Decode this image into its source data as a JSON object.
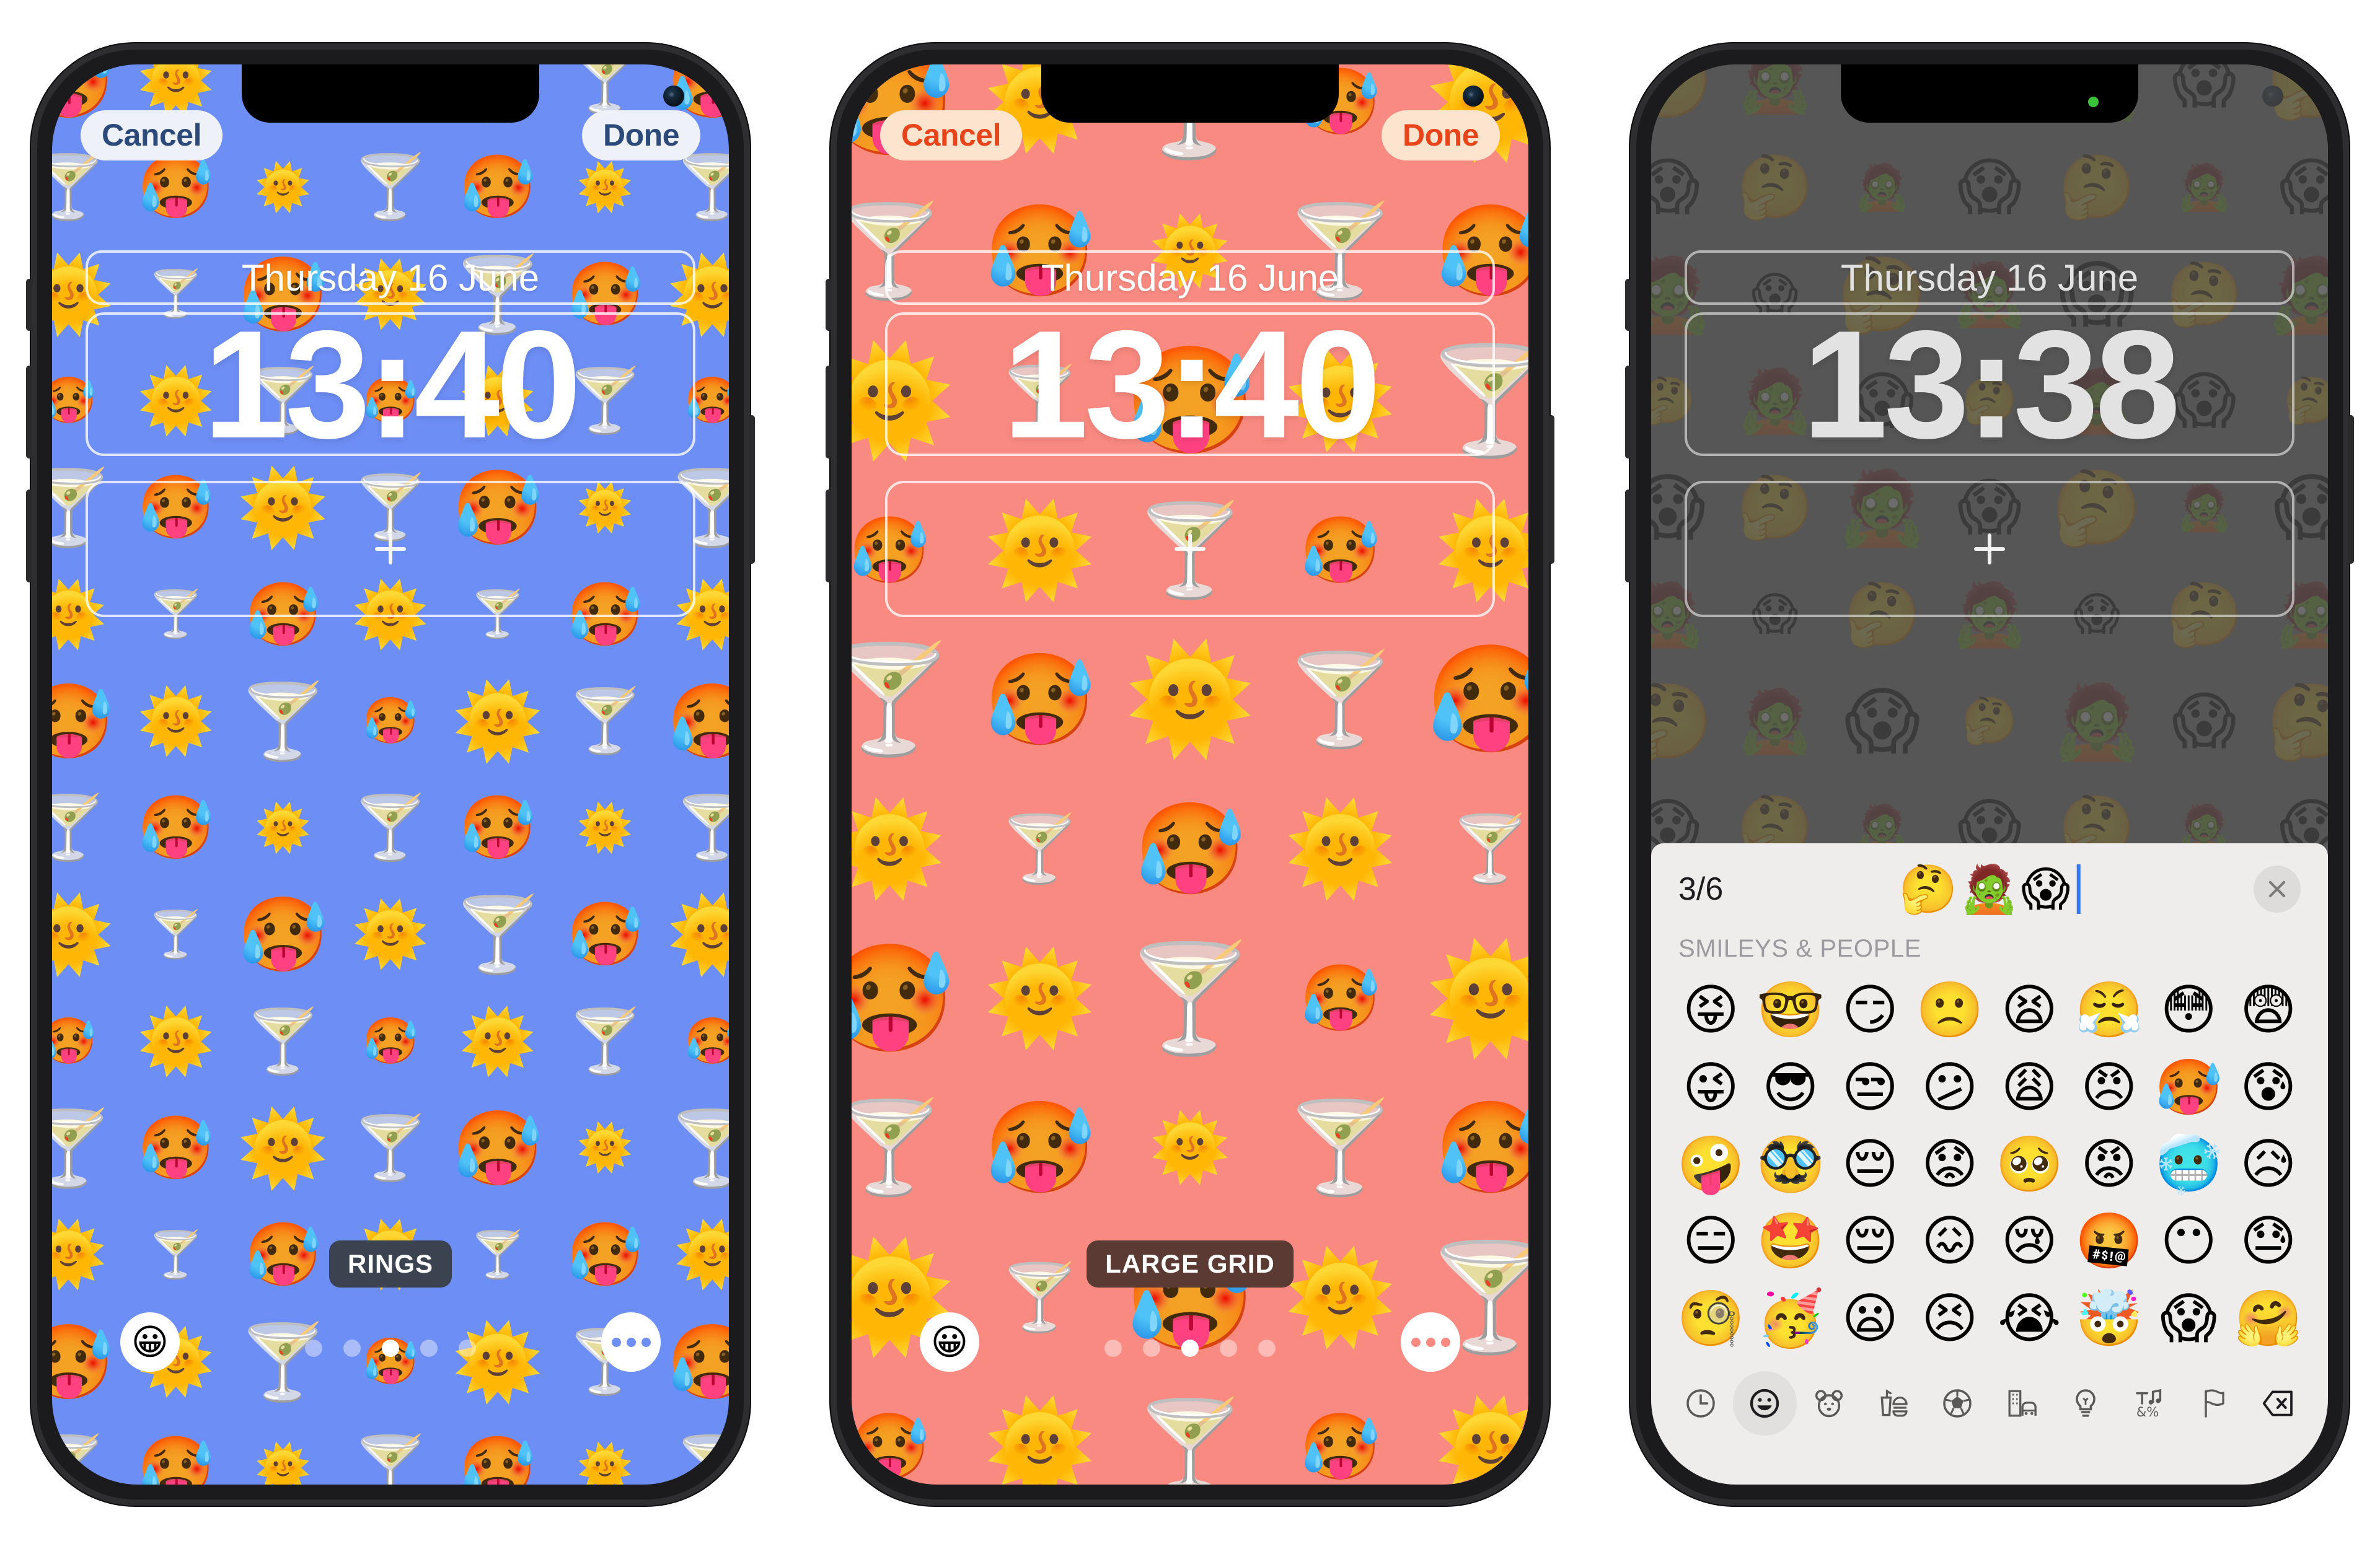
{
  "colors": {
    "phone1_bg": "#6d8ef5",
    "phone2_bg": "#f98a81",
    "phone3_bg": "#8a8a8a",
    "accent_blue": "#2b4a7a",
    "accent_red": "#e8441a",
    "badge_dark": "#3b4250",
    "badge_brown": "#5a3a33",
    "keyboard_bg": "#efedeb",
    "caret_blue": "#3478f6",
    "record_dot": "#3ac23a"
  },
  "phones": [
    {
      "id": "phone-blue",
      "cancel_label": "Cancel",
      "done_label": "Done",
      "date": "Thursday 16 June",
      "time": "13:40",
      "style_badge": "RINGS",
      "dots_count": 5,
      "dots_active": 2,
      "wallpaper_emojis": [
        "🥵",
        "🌞",
        "🍸"
      ],
      "bottom_left_icon": "😀",
      "bottom_right_icon": "three-dots"
    },
    {
      "id": "phone-pink",
      "cancel_label": "Cancel",
      "done_label": "Done",
      "date": "Thursday 16 June",
      "time": "13:40",
      "style_badge": "LARGE GRID",
      "dots_count": 5,
      "dots_active": 2,
      "wallpaper_emojis": [
        "🥵",
        "🌞",
        "🍸"
      ],
      "bottom_left_icon": "😀",
      "bottom_right_icon": "three-dots"
    },
    {
      "id": "phone-gray",
      "date": "Thursday 16 June",
      "time": "13:38",
      "wallpaper_emojis": [
        "🤔",
        "🧟",
        "😱"
      ]
    }
  ],
  "keyboard": {
    "counter": "3/6",
    "selected_emojis": [
      "🤔",
      "🧟",
      "😱"
    ],
    "close_label": "✕",
    "section_label": "SMILEYS & PEOPLE",
    "emoji_rows": [
      [
        "😝",
        "🤓",
        "😏",
        "🙁",
        "😫",
        "😤",
        "😳",
        "😨"
      ],
      [
        "😜",
        "😎",
        "😒",
        "😕",
        "😩",
        "😠",
        "🥵",
        "😰"
      ],
      [
        "🤪",
        "🥸",
        "😔",
        "😟",
        "🥺",
        "😡",
        "🥶",
        "😥"
      ],
      [
        "😑",
        "🤩",
        "😔",
        "😖",
        "😢",
        "🤬",
        "😶",
        "😓"
      ],
      [
        "🧐",
        "🥳",
        "😦",
        "😣",
        "😭",
        "🤯",
        "😱",
        "🤗"
      ]
    ],
    "categories": [
      {
        "name": "recents-category",
        "icon": "clock",
        "selected": false
      },
      {
        "name": "smileys-category",
        "icon": "smiley",
        "selected": true
      },
      {
        "name": "animals-category",
        "icon": "bear",
        "selected": false
      },
      {
        "name": "food-category",
        "icon": "food",
        "selected": false
      },
      {
        "name": "activity-category",
        "icon": "ball",
        "selected": false
      },
      {
        "name": "travel-category",
        "icon": "city",
        "selected": false
      },
      {
        "name": "objects-category",
        "icon": "bulb",
        "selected": false
      },
      {
        "name": "symbols-category",
        "icon": "symbols",
        "selected": false
      },
      {
        "name": "flags-category",
        "icon": "flag",
        "selected": false
      },
      {
        "name": "backspace-key",
        "icon": "backspace",
        "selected": false
      }
    ]
  }
}
